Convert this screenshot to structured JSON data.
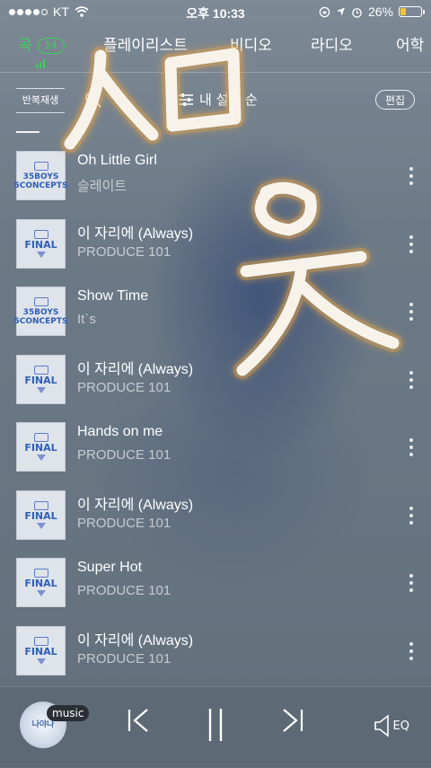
{
  "status_bar": {
    "carrier": "KT",
    "time": "오후 10:33",
    "battery_percent": "26%",
    "battery_level": 0.26,
    "battery_color": "#f4c430"
  },
  "tabs": [
    {
      "label": "곡",
      "badge": "14",
      "active": true
    },
    {
      "label": "플레이리스트",
      "active": false
    },
    {
      "label": "비디오",
      "active": false
    },
    {
      "label": "라디오",
      "active": false
    },
    {
      "label": "어학",
      "active": false
    }
  ],
  "toolbar": {
    "repeat_label": "반복재생",
    "settings_label": "내 설정 순",
    "edit_label": "편집"
  },
  "songs": [
    {
      "title": "Oh Little Girl",
      "artist": "슬레이트",
      "art_text": "35BOYS 5CONCEPTS"
    },
    {
      "title": "이 자리에 (Always)",
      "artist": "PRODUCE 101",
      "art_text": "FINAL"
    },
    {
      "title": "Show Time",
      "artist": "It`s",
      "art_text": "35BOYS 5CONCEPTS"
    },
    {
      "title": "이 자리에 (Always)",
      "artist": "PRODUCE 101",
      "art_text": "FINAL"
    },
    {
      "title": "Hands on me",
      "artist": "PRODUCE 101",
      "art_text": "FINAL"
    },
    {
      "title": "이 자리에 (Always)",
      "artist": "PRODUCE 101",
      "art_text": "FINAL"
    },
    {
      "title": "Super Hot",
      "artist": "PRODUCE 101",
      "art_text": "FINAL"
    },
    {
      "title": "이 자리에 (Always)",
      "artist": "PRODUCE 101",
      "art_text": "FINAL"
    }
  ],
  "player": {
    "art_text": "나야나",
    "tag": "music",
    "eq_label": "EQ"
  },
  "colors": {
    "accent_green": "#3ed15a",
    "doodle_stroke": "#f7f3ea",
    "doodle_glow": "#e0a14a"
  },
  "icons": [
    "search-icon",
    "sliders-icon",
    "more-icon",
    "prev-icon",
    "pause-icon",
    "next-icon",
    "speaker-icon",
    "wifi-icon",
    "alarm-icon",
    "location-icon"
  ]
}
